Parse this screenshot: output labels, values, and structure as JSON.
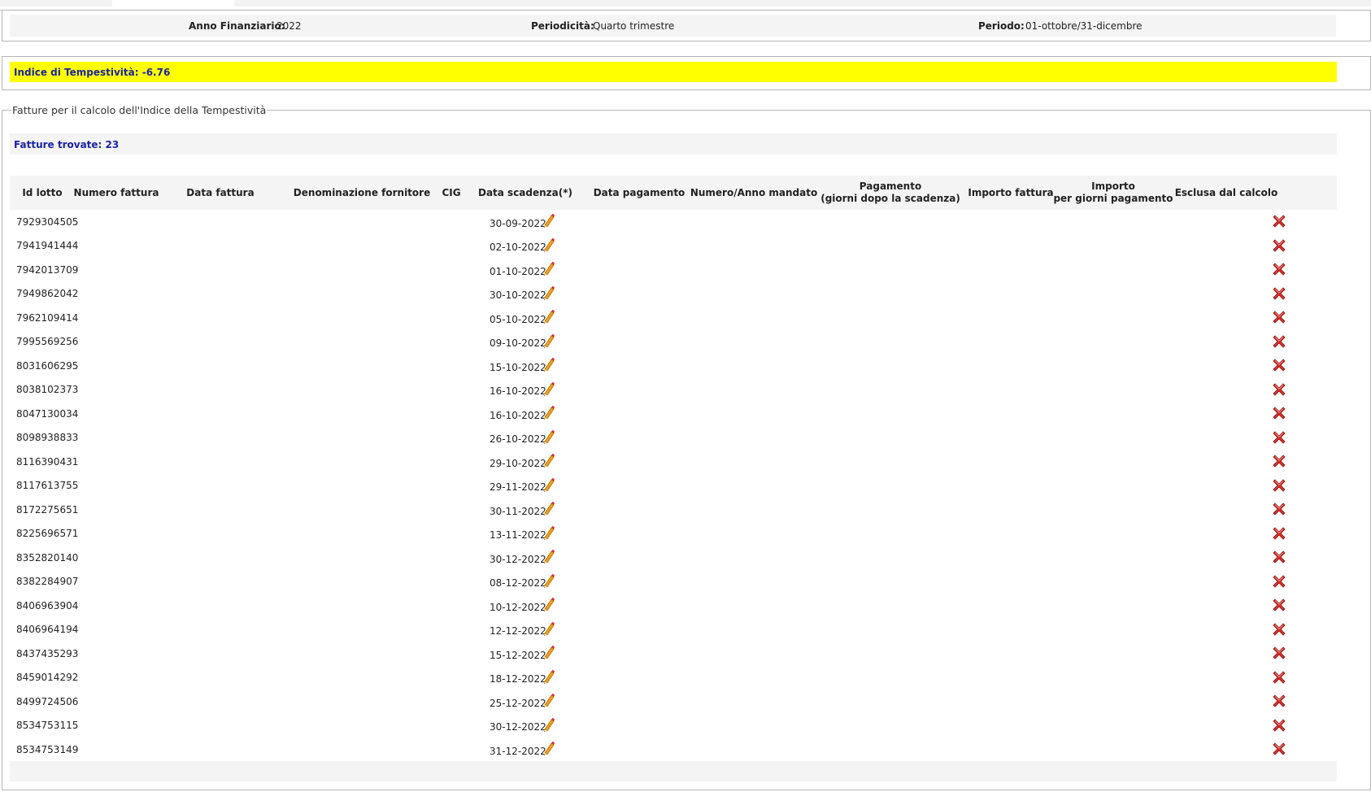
{
  "filters": {
    "anno_label": "Anno Finanziario:",
    "anno_value": "2022",
    "periodicita_label": "Periodicità:",
    "periodicita_value": "Quarto trimestre",
    "periodo_label": "Periodo:",
    "periodo_value": "01-ottobre/31-dicembre"
  },
  "index": {
    "text": "Indice di Tempestività: -6.76"
  },
  "section": {
    "legend": "Fatture per il calcolo dell'Indice della Tempestività",
    "found_text": "Fatture trovate: 23"
  },
  "table": {
    "headers": {
      "id_lotto": "Id lotto",
      "numero_fattura": "Numero fattura",
      "data_fattura": "Data fattura",
      "denominazione": "Denominazione fornitore",
      "cig": "CIG",
      "data_scadenza": "Data scadenza(*)",
      "data_pagamento": "Data pagamento",
      "numero_mandato": "Numero/Anno mandato",
      "pagamento_1": "Pagamento",
      "pagamento_2": "(giorni dopo la scadenza)",
      "importo_fattura": "Importo fattura",
      "importo_giorni_1": "Importo",
      "importo_giorni_2": "per giorni pagamento",
      "esclusa": "Esclusa dal calcolo"
    },
    "rows": [
      {
        "id_lotto": "7929304505",
        "data_scadenza": "30-09-2022"
      },
      {
        "id_lotto": "7941941444",
        "data_scadenza": "02-10-2022"
      },
      {
        "id_lotto": "7942013709",
        "data_scadenza": "01-10-2022"
      },
      {
        "id_lotto": "7949862042",
        "data_scadenza": "30-10-2022"
      },
      {
        "id_lotto": "7962109414",
        "data_scadenza": "05-10-2022"
      },
      {
        "id_lotto": "7995569256",
        "data_scadenza": "09-10-2022"
      },
      {
        "id_lotto": "8031606295",
        "data_scadenza": "15-10-2022"
      },
      {
        "id_lotto": "8038102373",
        "data_scadenza": "16-10-2022"
      },
      {
        "id_lotto": "8047130034",
        "data_scadenza": "16-10-2022"
      },
      {
        "id_lotto": "8098938833",
        "data_scadenza": "26-10-2022"
      },
      {
        "id_lotto": "8116390431",
        "data_scadenza": "29-10-2022"
      },
      {
        "id_lotto": "8117613755",
        "data_scadenza": "29-11-2022"
      },
      {
        "id_lotto": "8172275651",
        "data_scadenza": "30-11-2022"
      },
      {
        "id_lotto": "8225696571",
        "data_scadenza": "13-11-2022"
      },
      {
        "id_lotto": "8352820140",
        "data_scadenza": "30-12-2022"
      },
      {
        "id_lotto": "8382284907",
        "data_scadenza": "08-12-2022"
      },
      {
        "id_lotto": "8406963904",
        "data_scadenza": "10-12-2022"
      },
      {
        "id_lotto": "8406964194",
        "data_scadenza": "12-12-2022"
      },
      {
        "id_lotto": "8437435293",
        "data_scadenza": "15-12-2022"
      },
      {
        "id_lotto": "8459014292",
        "data_scadenza": "18-12-2022"
      },
      {
        "id_lotto": "8499724506",
        "data_scadenza": "25-12-2022"
      },
      {
        "id_lotto": "8534753115",
        "data_scadenza": "30-12-2022"
      },
      {
        "id_lotto": "8534753149",
        "data_scadenza": "31-12-2022"
      }
    ]
  },
  "icons": {
    "edit": "pencil-icon",
    "exclude": "close-icon"
  },
  "colors": {
    "highlight": "#ffff00",
    "link_text": "#1b23a8",
    "bar_bg": "#f4f4f4",
    "delete_red": "#d9302c",
    "pencil_orange": "#f0a01c"
  }
}
